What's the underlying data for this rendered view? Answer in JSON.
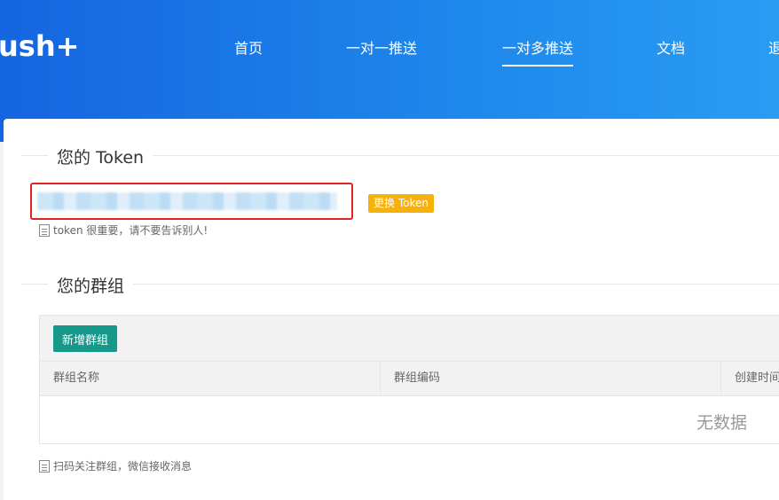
{
  "header": {
    "logo": "ush+",
    "nav": [
      {
        "label": "首页",
        "active": false
      },
      {
        "label": "一对一推送",
        "active": false
      },
      {
        "label": "一对多推送",
        "active": true
      },
      {
        "label": "文档",
        "active": false
      },
      {
        "label": "退",
        "active": false
      }
    ]
  },
  "token_section": {
    "title": "您的 Token",
    "change_button": "更换 Token",
    "hint": "token 很重要，请不要告诉别人!"
  },
  "group_section": {
    "title": "您的群组",
    "add_button": "新增群组",
    "columns": [
      "群组名称",
      "群组编码",
      "创建时间"
    ],
    "empty_text": "无数据",
    "hint": "扫码关注群组，微信接收消息"
  },
  "colors": {
    "header_start": "#1565e0",
    "header_end": "#2a9cf2",
    "token_box_border": "#e02424",
    "change_button_bg": "#f6b10d",
    "add_button_bg": "#16998a"
  }
}
